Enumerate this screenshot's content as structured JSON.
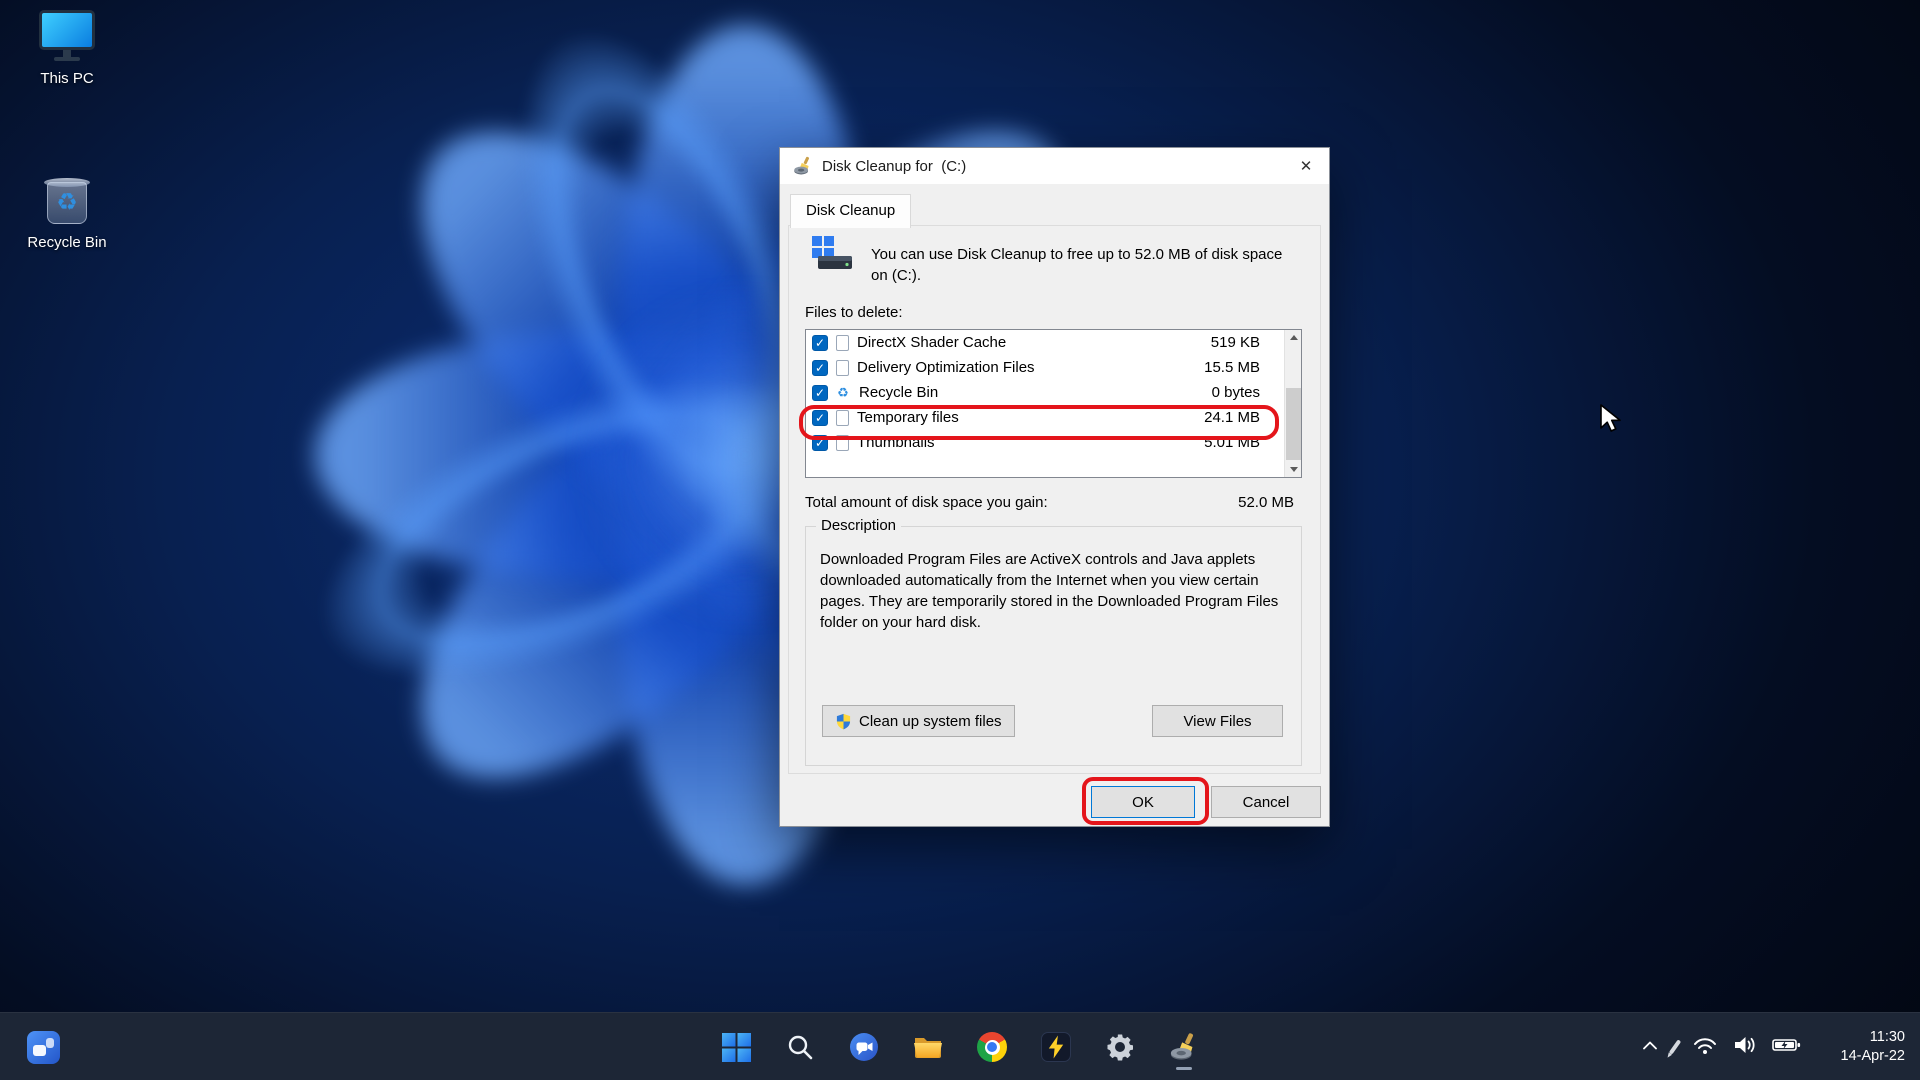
{
  "desktop": {
    "icons": [
      {
        "label": "This PC"
      },
      {
        "label": "Recycle Bin"
      }
    ]
  },
  "dialog": {
    "title": "Disk Cleanup for  (C:)",
    "tab": "Disk Cleanup",
    "intro": "You can use Disk Cleanup to free up to 52.0 MB of disk space on  (C:).",
    "files_label": "Files to delete:",
    "files": [
      {
        "name": "DirectX Shader Cache",
        "size": "519 KB",
        "checked": true
      },
      {
        "name": "Delivery Optimization Files",
        "size": "15.5 MB",
        "checked": true
      },
      {
        "name": "Recycle Bin",
        "size": "0 bytes",
        "checked": true
      },
      {
        "name": "Temporary files",
        "size": "24.1 MB",
        "checked": true,
        "highlighted": true
      },
      {
        "name": "Thumbnails",
        "size": "5.01 MB",
        "checked": true
      }
    ],
    "total_label": "Total amount of disk space you gain:",
    "total_value": "52.0 MB",
    "description_title": "Description",
    "description_body": "Downloaded Program Files are ActiveX controls and Java applets downloaded automatically from the Internet when you view certain pages. They are temporarily stored in the Downloaded Program Files folder on your hard disk.",
    "buttons": {
      "cleanup": "Clean up system files",
      "view_files": "View Files",
      "ok": "OK",
      "cancel": "Cancel"
    },
    "annotations": {
      "highlight_color": "#e4151b",
      "highlighted_row": "Temporary files",
      "highlighted_button": "OK"
    }
  },
  "taskbar": {
    "icons": [
      "widgets",
      "start",
      "search",
      "chat",
      "file-explorer",
      "chrome",
      "lightning-app",
      "settings",
      "disk-cleanup"
    ],
    "tray_icons": [
      "chevron-up",
      "pen",
      "wifi",
      "volume",
      "battery-charging"
    ],
    "clock_time": "11:30",
    "clock_date": "14-Apr-22"
  }
}
